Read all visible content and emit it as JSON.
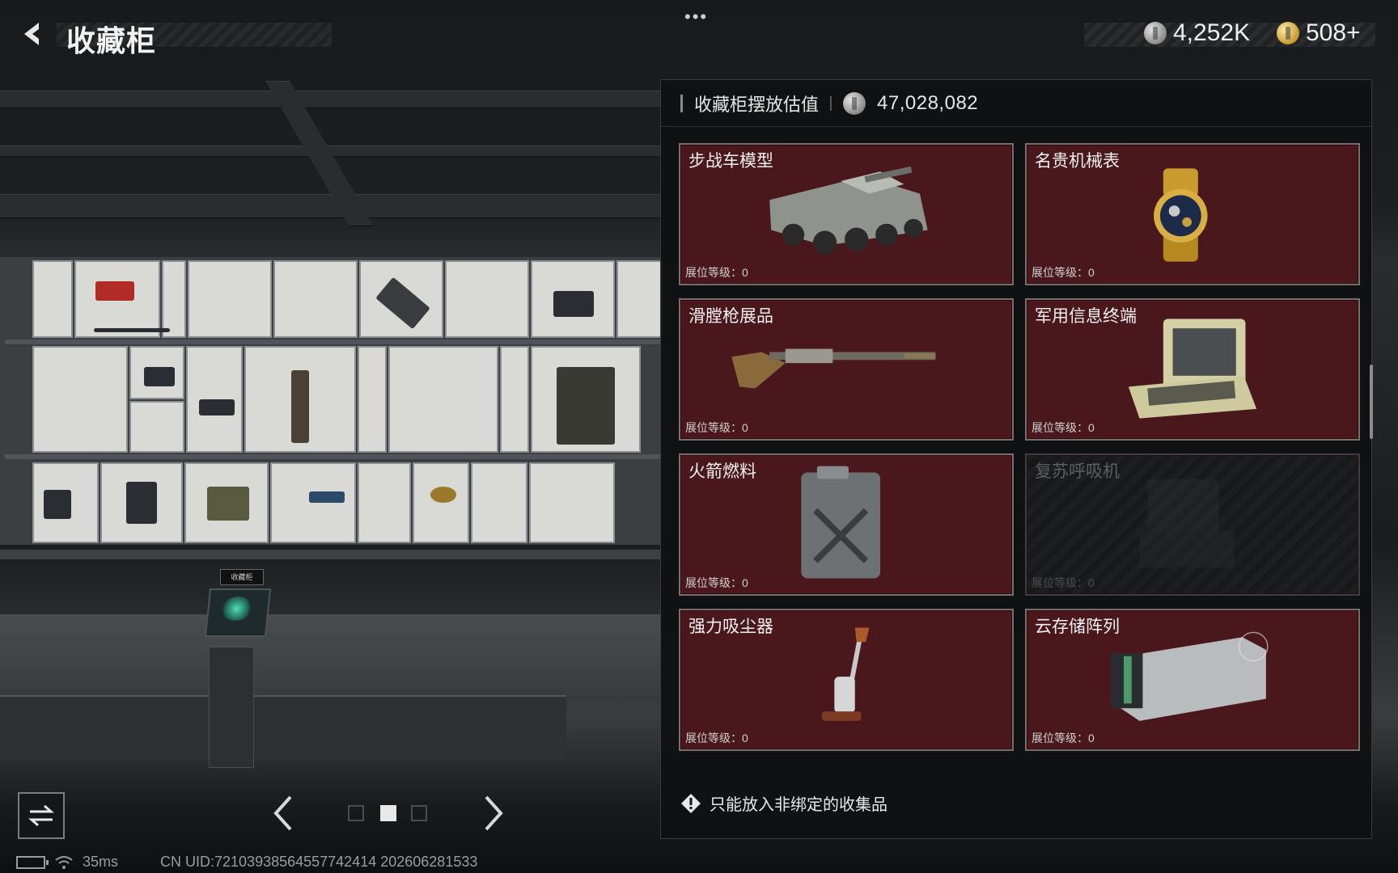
{
  "header": {
    "title": "收藏柜",
    "menu_dots": "•••"
  },
  "currency": {
    "silver": "4,252K",
    "gold": "508+"
  },
  "panel": {
    "value_label": "收藏柜摆放估值",
    "value": "47,028,082",
    "notice": "只能放入非绑定的收集品"
  },
  "items": [
    {
      "name": "步战车模型",
      "level": "展位等级：0",
      "locked": false
    },
    {
      "name": "名贵机械表",
      "level": "展位等级：0",
      "locked": false
    },
    {
      "name": "滑膛枪展品",
      "level": "展位等级：0",
      "locked": false
    },
    {
      "name": "军用信息终端",
      "level": "展位等级：0",
      "locked": false
    },
    {
      "name": "火箭燃料",
      "level": "展位等级：0",
      "locked": false
    },
    {
      "name": "复苏呼吸机",
      "level": "展位等级：0",
      "locked": true
    },
    {
      "name": "强力吸尘器",
      "level": "展位等级：0",
      "locked": false
    },
    {
      "name": "云存储阵列",
      "level": "展位等级：0",
      "locked": false
    }
  ],
  "scene": {
    "sign_text": "收藏柜"
  },
  "status": {
    "ping": "35ms",
    "uid": "CN UID:7210393856455774241​4 202606281533"
  },
  "colors": {
    "card_bg": "#4a181c",
    "panel_bg": "#101112",
    "accent_gold": "#c99a2e"
  }
}
